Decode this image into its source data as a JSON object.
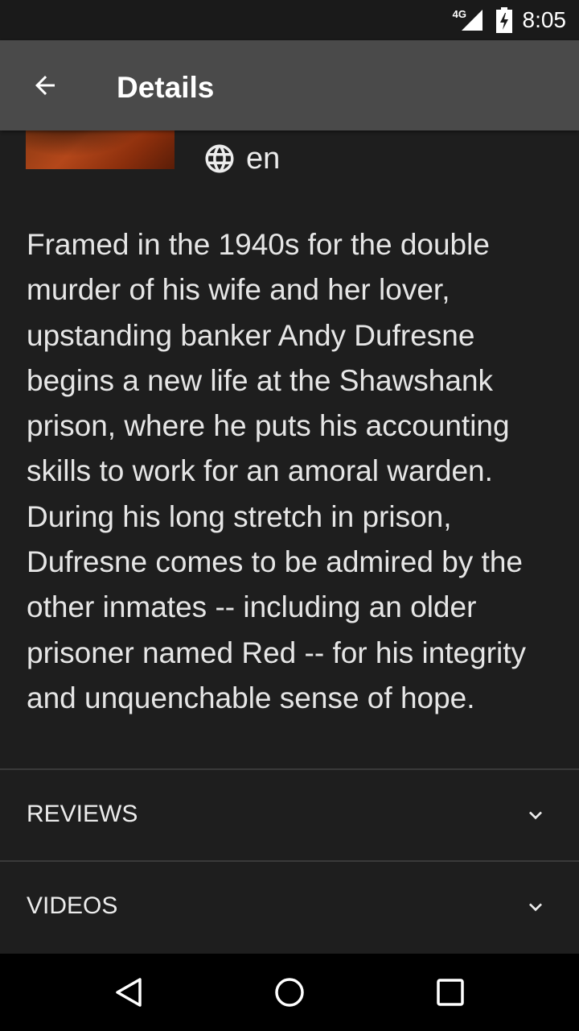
{
  "status_bar": {
    "network": "4G",
    "time": "8:05"
  },
  "app_bar": {
    "title": "Details"
  },
  "movie": {
    "language": "en",
    "overview": "Framed in the 1940s for the double murder of his wife and her lover, upstanding banker Andy Dufresne begins a new life at the Shawshank prison, where he puts his accounting skills to work for an amoral warden. During his long stretch in prison, Dufresne comes to be admired by the other inmates -- including an older prisoner named Red -- for his integrity and unquenchable sense of hope."
  },
  "sections": {
    "reviews": "REVIEWS",
    "videos": "VIDEOS"
  }
}
